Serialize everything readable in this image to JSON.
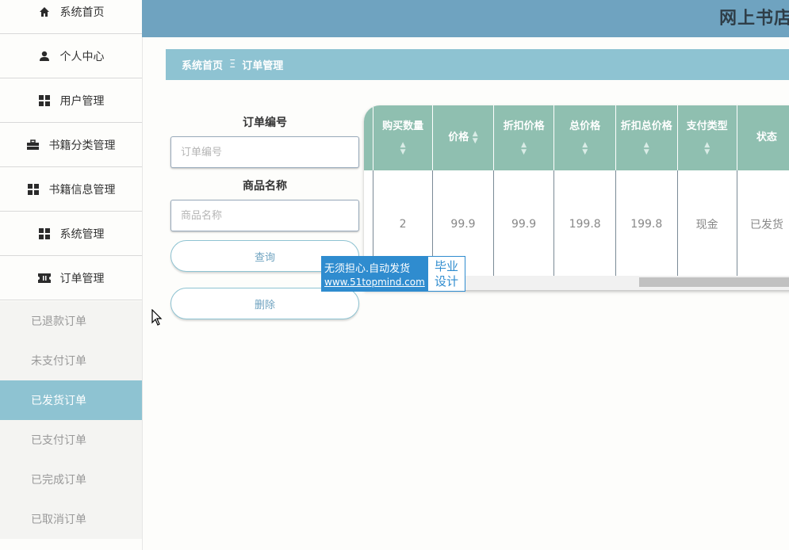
{
  "sidebar": {
    "items": [
      {
        "label": "系统首页",
        "icon": "home-icon"
      },
      {
        "label": "个人中心",
        "icon": "user-icon"
      },
      {
        "label": "用户管理",
        "icon": "grid-icon"
      },
      {
        "label": "书籍分类管理",
        "icon": "briefcase-icon"
      },
      {
        "label": "书籍信息管理",
        "icon": "grid-icon"
      },
      {
        "label": "系统管理",
        "icon": "grid-icon"
      },
      {
        "label": "订单管理",
        "icon": "ticket-icon"
      }
    ],
    "order_sub_items": [
      {
        "label": "已退款订单"
      },
      {
        "label": "未支付订单"
      },
      {
        "label": "已发货订单",
        "active": true
      },
      {
        "label": "已支付订单"
      },
      {
        "label": "已完成订单"
      },
      {
        "label": "已取消订单"
      }
    ]
  },
  "header": {
    "title": "网上书店"
  },
  "breadcrumb": {
    "home": "系统首页",
    "separator": "Ξ",
    "current": "订单管理"
  },
  "search": {
    "order_no_label": "订单编号",
    "order_no_placeholder": "订单编号",
    "product_name_label": "商品名称",
    "product_name_placeholder": "商品名称",
    "query_button": "查询",
    "delete_button": "删除"
  },
  "table": {
    "columns": [
      "购买数量",
      "价格",
      "折扣价格",
      "总价格",
      "折扣总价格",
      "支付类型",
      "状态"
    ],
    "rows": [
      [
        "2",
        "99.9",
        "99.9",
        "199.8",
        "199.8",
        "现金",
        "已发货"
      ]
    ]
  },
  "watermark": {
    "line1": "无须担心.自动发货",
    "line2": "www.51topmind.com",
    "tag1": "毕业",
    "tag2": "设计"
  },
  "colors": {
    "header_bg": "#6fa3c0",
    "breadcrumb_bg": "#8ec3d2",
    "table_header_bg": "#8fbfb0",
    "active_menu_bg": "#8ec3d2"
  }
}
